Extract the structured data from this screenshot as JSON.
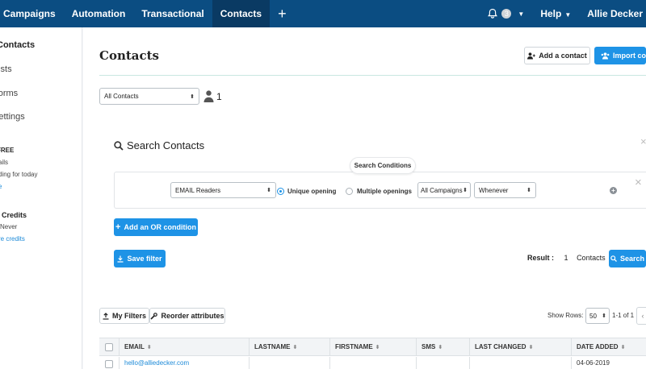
{
  "topnav": {
    "items": [
      {
        "label": "Campaigns",
        "active": false
      },
      {
        "label": "Automation",
        "active": false
      },
      {
        "label": "Transactional",
        "active": false
      },
      {
        "label": "Contacts",
        "active": true
      }
    ],
    "add_icon": "plus-icon",
    "notification_count": "3",
    "help_label": "Help",
    "user_label": "Allie Decker"
  },
  "sidebar": {
    "items": [
      "Contacts",
      "Lists",
      "Forms",
      "Settings"
    ],
    "plan_title": "FREE",
    "plan_line1": "ails",
    "plan_line2": "ding for today",
    "plan_link": "e",
    "credits_title": "Credits",
    "credits_line": "Never",
    "credits_link": "re credits"
  },
  "page": {
    "title": "Contacts",
    "add_contact_label": "Add a contact",
    "import_label": "Import contacts"
  },
  "filter": {
    "list_select": "All Contacts",
    "contact_count": "1"
  },
  "search": {
    "title": "Search Contacts",
    "conditions_label": "Search Conditions",
    "field_select": "EMAIL Readers",
    "radio_unique": "Unique opening",
    "radio_multiple": "Multiple openings",
    "selected_radio": "unique",
    "campaign_select": "All Campaigns",
    "time_select": "Whenever",
    "add_or_label": "Add an OR condition",
    "save_filter_label": "Save filter",
    "result_label": "Result :",
    "result_count": "1",
    "result_unit": "Contacts",
    "search_button": "Search"
  },
  "table_tools": {
    "my_filters": "My Filters",
    "reorder": "Reorder attributes",
    "show_rows_label": "Show Rows:",
    "rows_value": "50",
    "pager_text": "1-1 of 1"
  },
  "table": {
    "columns": [
      "EMAIL",
      "LASTNAME",
      "FIRSTNAME",
      "SMS",
      "LAST CHANGED",
      "DATE ADDED"
    ],
    "rows": [
      {
        "email": "hello@alliedecker.com",
        "lastname": "",
        "firstname": "",
        "sms": "",
        "last_changed": "",
        "date_added": "04-06-2019"
      }
    ]
  },
  "colors": {
    "nav_bg": "#0b4d82",
    "nav_active": "#0a3a63",
    "accent": "#1e93e6",
    "link": "#1c8ad8"
  }
}
